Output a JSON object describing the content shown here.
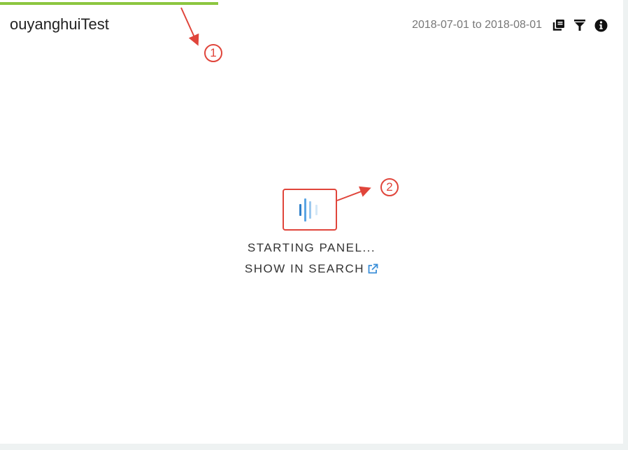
{
  "panel": {
    "title": "ouyanghuiTest",
    "time_range": "2018-07-01 to 2018-08-01",
    "load_progress": 0.35
  },
  "loading": {
    "status_text": "STARTING PANEL...",
    "show_in_search_label": "SHOW IN SEARCH"
  },
  "annotations": {
    "marker_1": "1",
    "marker_2": "2",
    "color": "#e0453b"
  },
  "colors": {
    "progress": "#8cc63f",
    "link_icon": "#3b8fd9",
    "spinner": "#3b8fd9"
  },
  "icons": [
    "stack-icon",
    "filter-icon",
    "info-icon",
    "external-link-icon"
  ]
}
